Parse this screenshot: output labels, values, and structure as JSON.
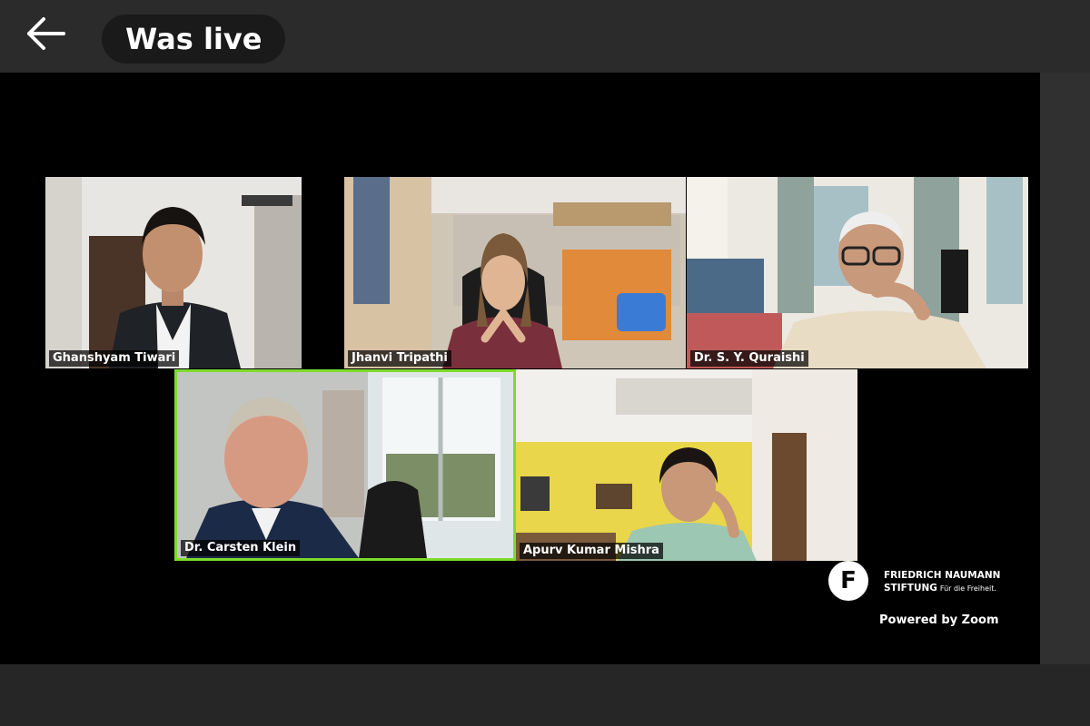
{
  "header": {
    "status_label": "Was live"
  },
  "participants": [
    {
      "name": "Ghanshyam Tiwari"
    },
    {
      "name": "Jhanvi Tripathi"
    },
    {
      "name": "Dr. S. Y. Quraishi"
    },
    {
      "name": "Dr. Carsten Klein",
      "active_speaker": true
    },
    {
      "name": "Apurv Kumar Mishra"
    }
  ],
  "branding": {
    "logo_letter": "F",
    "org_line1": "FRIEDRICH NAUMANN",
    "org_line2": "STIFTUNG",
    "org_tagline": "Für die Freiheit.",
    "powered_by": "Powered by Zoom"
  },
  "colors": {
    "active_speaker_border": "#7ddc2b",
    "stage_background": "#000000"
  }
}
